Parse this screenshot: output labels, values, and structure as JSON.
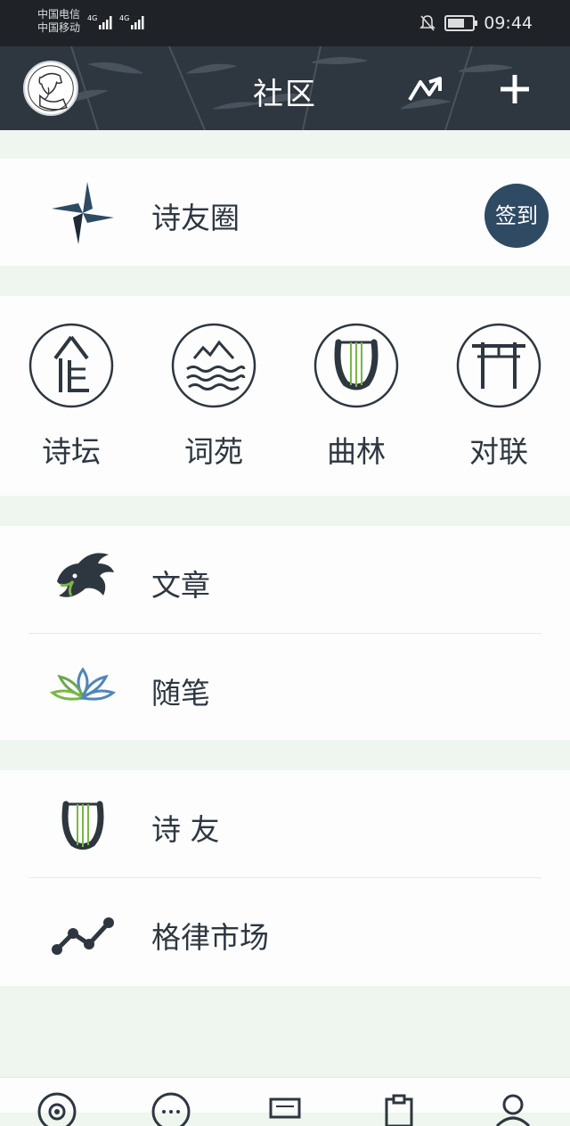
{
  "status_bar": {
    "carrier_1": "中国电信",
    "carrier_2": "中国移动",
    "network_1": "4G",
    "network_2": "4G",
    "time": "09:44",
    "icons": [
      "bell-off-icon",
      "battery-icon"
    ]
  },
  "header": {
    "title": "社区",
    "avatar_icon": "poet-avatar-icon",
    "trend_icon": "trend-icon",
    "add_icon": "plus-icon"
  },
  "poetry_circle": {
    "label": "诗友圈",
    "icon": "pinwheel-icon",
    "signin_label": "签到"
  },
  "categories": [
    {
      "label": "诗坛",
      "icon": "pavilion-icon"
    },
    {
      "label": "词苑",
      "icon": "mountain-wave-icon"
    },
    {
      "label": "曲林",
      "icon": "lyre-icon"
    },
    {
      "label": "对联",
      "icon": "gate-icon"
    }
  ],
  "section_articles": [
    {
      "label": "文章",
      "icon": "dragon-icon"
    },
    {
      "label": "随笔",
      "icon": "lotus-icon"
    }
  ],
  "section_friends": [
    {
      "label": "诗 友",
      "icon": "lyre-icon"
    },
    {
      "label": "格律市场",
      "icon": "line-chart-icon"
    }
  ],
  "tabbar": {
    "tabs": [
      {
        "icon": "target-icon"
      },
      {
        "icon": "chat-bubble-icon"
      },
      {
        "icon": "scroll-icon"
      },
      {
        "icon": "clipboard-icon"
      },
      {
        "icon": "profile-icon"
      }
    ]
  },
  "colors": {
    "header_bg": "#2e3640",
    "accent": "#2f4a63",
    "page_bg": "#eef6ef",
    "text": "#2e3640"
  }
}
